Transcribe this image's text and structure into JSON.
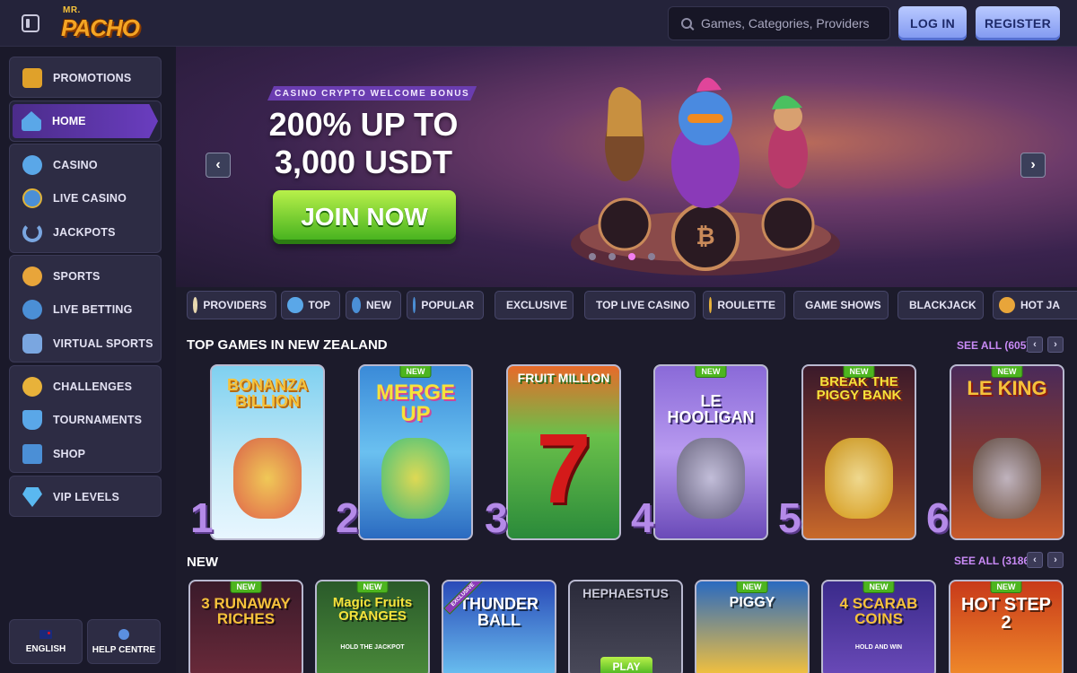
{
  "header": {
    "logo_top": "MR.",
    "logo_main": "PACHO",
    "search_placeholder": "Games, Categories, Providers",
    "login_label": "LOG IN",
    "register_label": "REGISTER"
  },
  "sidebar": {
    "promotions": "PROMOTIONS",
    "home": "HOME",
    "casino": "CASINO",
    "live_casino": "LIVE CASINO",
    "jackpots": "JACKPOTS",
    "sports": "SPORTS",
    "live_betting": "LIVE BETTING",
    "virtual_sports": "VIRTUAL SPORTS",
    "challenges": "CHALLENGES",
    "tournaments": "TOURNAMENTS",
    "shop": "SHOP",
    "vip_levels": "VIP LEVELS",
    "language": "ENGLISH",
    "help": "HELP CENTRE"
  },
  "banner": {
    "tag": "CASINO CRYPTO WELCOME BONUS",
    "title_line1": "200% UP TO",
    "title_line2": "3,000 USDT",
    "cta": "JOIN NOW",
    "slide_count": 4,
    "active_slide": 3
  },
  "categories": [
    "PROVIDERS",
    "TOP",
    "NEW",
    "POPULAR",
    "EXCLUSIVE",
    "TOP LIVE CASINO",
    "ROULETTE",
    "GAME SHOWS",
    "BLACKJACK",
    "HOT JA"
  ],
  "top_games": {
    "title": "TOP GAMES IN NEW ZEALAND",
    "see_all": "SEE ALL (605)",
    "games": [
      {
        "rank": "1",
        "name": "BONANZA BILLION",
        "new": ""
      },
      {
        "rank": "2",
        "name": "MERGE UP",
        "new": "NEW"
      },
      {
        "rank": "3",
        "name": "FRUIT MILLION",
        "new": ""
      },
      {
        "rank": "4",
        "name": "LE HOOLIGAN",
        "new": "NEW"
      },
      {
        "rank": "5",
        "name": "BREAK THE PIGGY BANK",
        "new": "NEW"
      },
      {
        "rank": "6",
        "name": "LE KING",
        "new": "NEW"
      }
    ]
  },
  "new_games": {
    "title": "NEW",
    "see_all": "SEE ALL (3186)",
    "badge": "NEW",
    "exclusive": "EXCLUSIVE",
    "play": "PLAY",
    "games": [
      "3 RUNAWAY RICHES",
      "Magic Fruits ORANGES",
      "THUNDER BALL",
      "HEPHAESTUS",
      "PIGGY",
      "4 SCARAB COINS",
      "HOT STEP 2"
    ],
    "sub_hold": "HOLD THE JACKPOT",
    "sub_holdwin": "HOLD AND WIN"
  },
  "colors": {
    "accent": "#6a3dbf",
    "cta_green": "#3fae1c",
    "link_purple": "#c98af6"
  }
}
